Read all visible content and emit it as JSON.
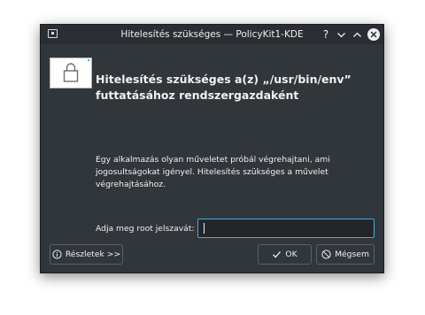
{
  "window": {
    "title": "Hitelesítés szükséges — PolicyKit1-KDE",
    "help_label": "?"
  },
  "heading": "Hitelesítés szükséges a(z) „/usr/bin/env” futtatásához rendszergazdaként",
  "description": "Egy alkalmazás olyan műveletet próbál végrehajtani, ami jogosultságokat igényel. Hitelesítés szükséges a művelet végrehajtásához.",
  "password": {
    "label": "Adja meg root jelszavát:",
    "value": ""
  },
  "buttons": {
    "details": "Részletek >>",
    "ok": "OK",
    "cancel": "Mégsem"
  },
  "colors": {
    "window_bg": "#31363b",
    "titlebar_bg": "#2a2e32",
    "text": "#eff0f1",
    "focus_accent": "#3daee9"
  },
  "icons": {
    "window": "app-window-icon",
    "lock": "lock-icon",
    "help": "help-icon",
    "minimize": "chevron-down-icon",
    "maximize": "chevron-up-icon",
    "close": "close-icon",
    "details": "info-icon",
    "ok": "checkmark-icon",
    "cancel": "cancel-icon"
  }
}
